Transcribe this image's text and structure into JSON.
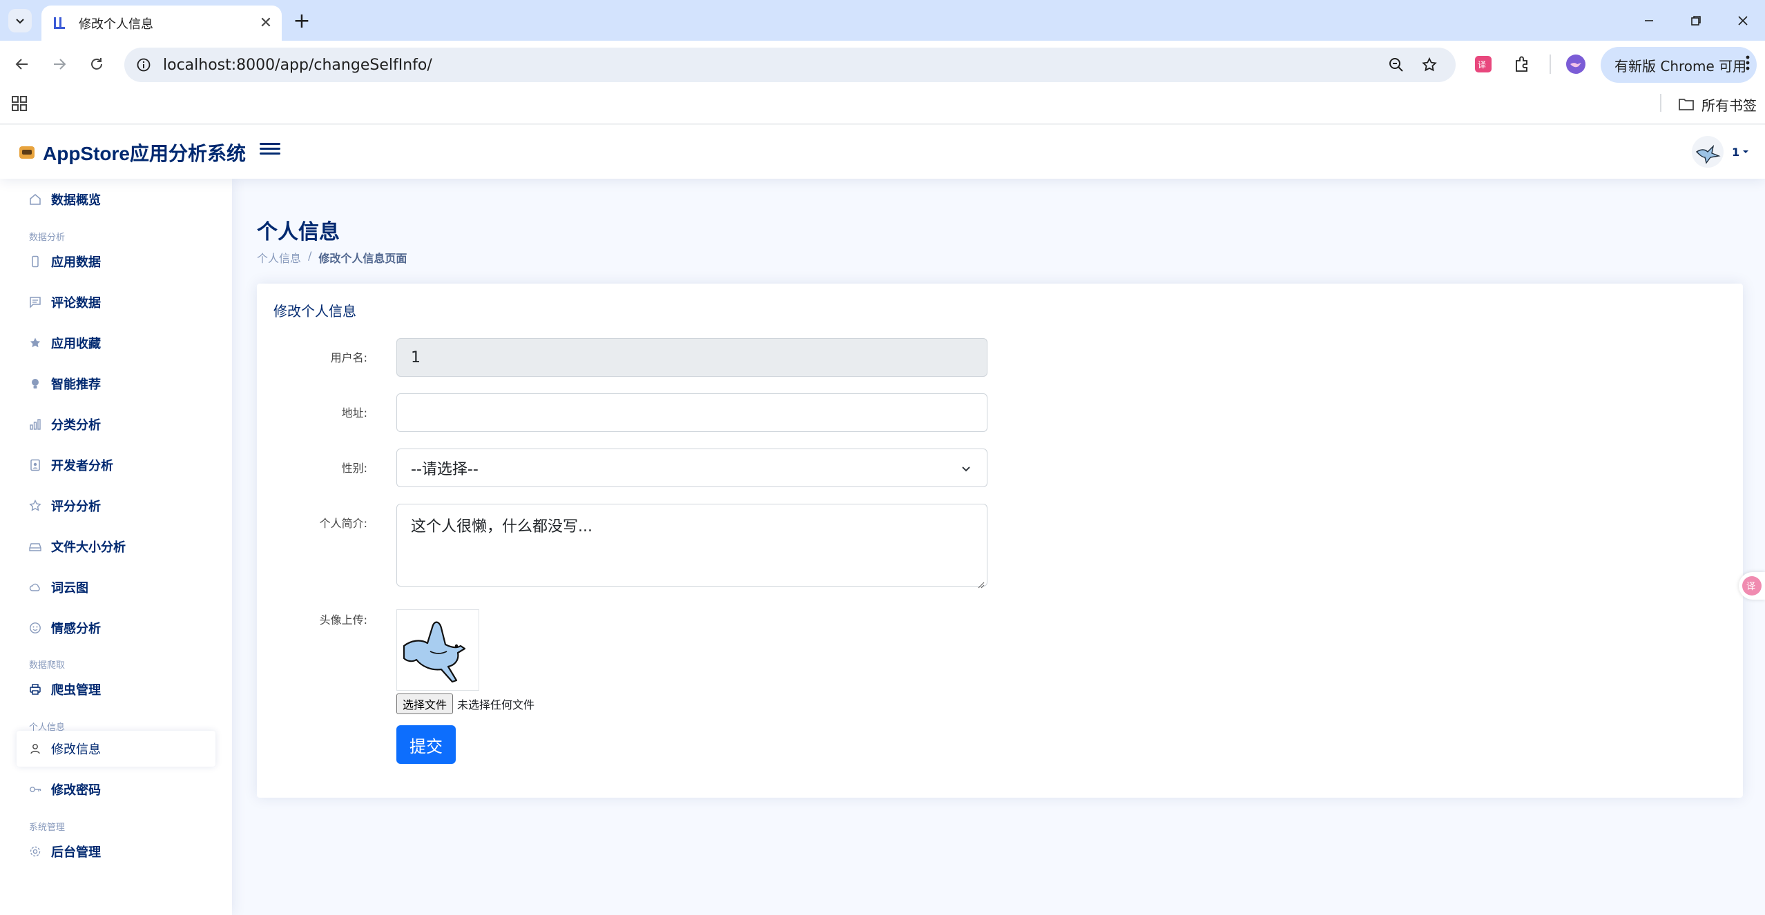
{
  "browser": {
    "tab_title": "修改个人信息",
    "url": "localhost:8000/app/changeSelfInfo/",
    "update_label": "有新版 Chrome 可用",
    "all_bookmarks": "所有书签",
    "close_glyph": "✕",
    "new_tab_glyph": "+"
  },
  "header": {
    "brand": "AppStore应用分析系统",
    "username": "1"
  },
  "sidebar": {
    "items": [
      {
        "label": "数据概览",
        "icon": "house-icon"
      },
      {
        "heading": "数据分析"
      },
      {
        "label": "应用数据",
        "icon": "phone-icon"
      },
      {
        "label": "评论数据",
        "icon": "chat-icon"
      },
      {
        "label": "应用收藏",
        "icon": "star-fill-icon"
      },
      {
        "label": "智能推荐",
        "icon": "lightbulb-icon"
      },
      {
        "label": "分类分析",
        "icon": "bar-chart-icon"
      },
      {
        "label": "开发者分析",
        "icon": "person-badge-icon"
      },
      {
        "label": "评分分析",
        "icon": "star-icon"
      },
      {
        "label": "文件大小分析",
        "icon": "hdd-icon"
      },
      {
        "label": "词云图",
        "icon": "cloud-icon"
      },
      {
        "label": "情感分析",
        "icon": "emoji-icon"
      },
      {
        "heading": "数据爬取"
      },
      {
        "label": "爬虫管理",
        "icon": "printer-icon"
      },
      {
        "heading": "个人信息"
      },
      {
        "label": "修改信息",
        "icon": "person-icon",
        "active": true
      },
      {
        "label": "修改密码",
        "icon": "key-icon"
      },
      {
        "heading": "系统管理"
      },
      {
        "label": "后台管理",
        "icon": "gear-icon"
      }
    ]
  },
  "page": {
    "title": "个人信息",
    "breadcrumb": [
      "个人信息",
      "修改个人信息页面"
    ],
    "breadcrumb_sep": "/"
  },
  "form": {
    "card_title": "修改个人信息",
    "username_label": "用户名:",
    "username_value": "1",
    "address_label": "地址:",
    "address_value": "",
    "gender_label": "性别:",
    "gender_value": "--请选择--",
    "bio_label": "个人简介:",
    "bio_value": "这个人很懒，什么都没写...",
    "avatar_label": "头像上传:",
    "file_button": "选择文件",
    "file_status": "未选择任何文件",
    "submit": "提交"
  },
  "colors": {
    "primary": "#0d6efd",
    "navy": "#012970",
    "chrome_blue": "#d3e3fd",
    "page_bg": "#f6f9ff"
  }
}
